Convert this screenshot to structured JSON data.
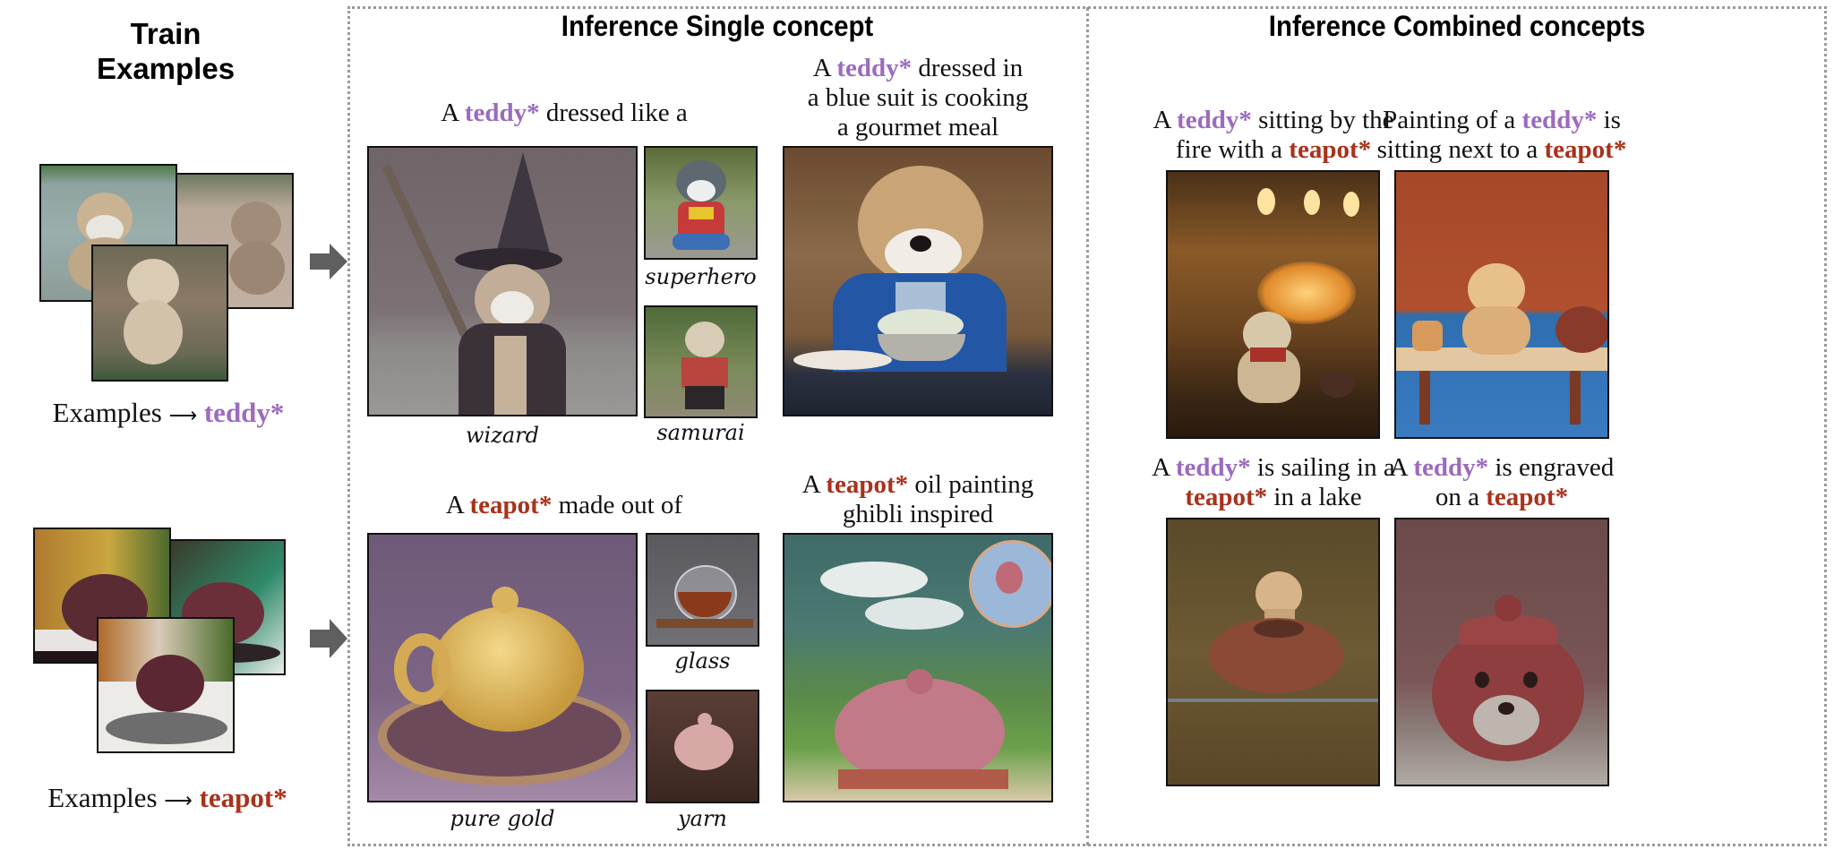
{
  "figure": {
    "train_panel": {
      "title_line1": "Train",
      "title_line2": "Examples",
      "groups": [
        {
          "concept": "teddy",
          "label_prefix": "Examples",
          "arrow_glyph": "⟶",
          "token": "teddy*",
          "token_color": "#9b6bbf",
          "images": [
            "teddy bear on gravel path",
            "teddy bear on sandy ground",
            "teddy bear sitting on wooden bench"
          ]
        },
        {
          "concept": "teapot",
          "label_prefix": "Examples",
          "arrow_glyph": "⟶",
          "token": "teapot*",
          "token_color": "#a8321c",
          "images": [
            "purple clay teapot on table",
            "purple clay teapot on tray",
            "purple clay teapot on round tray"
          ]
        }
      ]
    },
    "single_panel": {
      "title": "Inference Single concept",
      "rows": [
        {
          "prompt": {
            "pre": "A ",
            "token": "teddy*",
            "post": " dressed like a"
          },
          "main_image": {
            "desc": "teddy bear as wizard with hat and staff",
            "label": "wizard"
          },
          "small_images": [
            {
              "desc": "teddy bear superhero costume",
              "label": "superhero"
            },
            {
              "desc": "teddy bear samurai",
              "label": "samurai"
            }
          ],
          "side_prompt": {
            "pre": "A ",
            "token": "teddy*",
            "post_lines": [
              " dressed in",
              "a blue suit is cooking",
              "a gourmet meal"
            ]
          },
          "side_image": {
            "desc": "teddy bear in blue suit cooking"
          }
        },
        {
          "prompt": {
            "pre": "A ",
            "token": "teapot*",
            "post": " made out of"
          },
          "main_image": {
            "desc": "gold teapot on plate",
            "label": "pure gold"
          },
          "small_images": [
            {
              "desc": "glass teapot with tea",
              "label": "glass"
            },
            {
              "desc": "knitted yarn teapot",
              "label": "yarn"
            }
          ],
          "side_prompt": {
            "pre": "A ",
            "token": "teapot*",
            "post_lines": [
              " oil painting",
              "ghibli inspired"
            ]
          },
          "side_image": {
            "desc": "ghibli style painted pink teapot with clouds"
          }
        }
      ]
    },
    "combined_panel": {
      "title": "Inference Combined concepts",
      "items": [
        {
          "line1": [
            {
              "t": "A "
            },
            {
              "t": "teddy*",
              "k": "teddy"
            },
            {
              "t": " sitting by the"
            }
          ],
          "line2": [
            {
              "t": "fire with a "
            },
            {
              "t": "teapot*",
              "k": "teapot"
            }
          ],
          "desc": "teddy by fireplace with teapot"
        },
        {
          "line1": [
            {
              "t": "Painting of a "
            },
            {
              "t": "teddy*",
              "k": "teddy"
            },
            {
              "t": " is"
            }
          ],
          "line2": [
            {
              "t": "sitting next to a "
            },
            {
              "t": "teapot*",
              "k": "teapot"
            }
          ],
          "desc": "painting of teddy on bench with teapot"
        },
        {
          "line1": [
            {
              "t": "A "
            },
            {
              "t": "teddy*",
              "k": "teddy"
            },
            {
              "t": " is sailing in a"
            }
          ],
          "line2": [
            {
              "t": "teapot*",
              "k": "teapot"
            },
            {
              "t": " in a lake"
            }
          ],
          "desc": "teddy sailing in teapot on lake"
        },
        {
          "line1": [
            {
              "t": "A "
            },
            {
              "t": "teddy*",
              "k": "teddy"
            },
            {
              "t": " is engraved"
            }
          ],
          "line2": [
            {
              "t": "on a "
            },
            {
              "t": "teapot*",
              "k": "teapot"
            }
          ],
          "desc": "teapot with engraved bear face"
        }
      ]
    },
    "colors": {
      "teddy_token": "#9b6bbf",
      "teapot_token": "#a8321c",
      "arrow": "#5f5f5f",
      "dotted_border": "#9a9a9a"
    }
  }
}
